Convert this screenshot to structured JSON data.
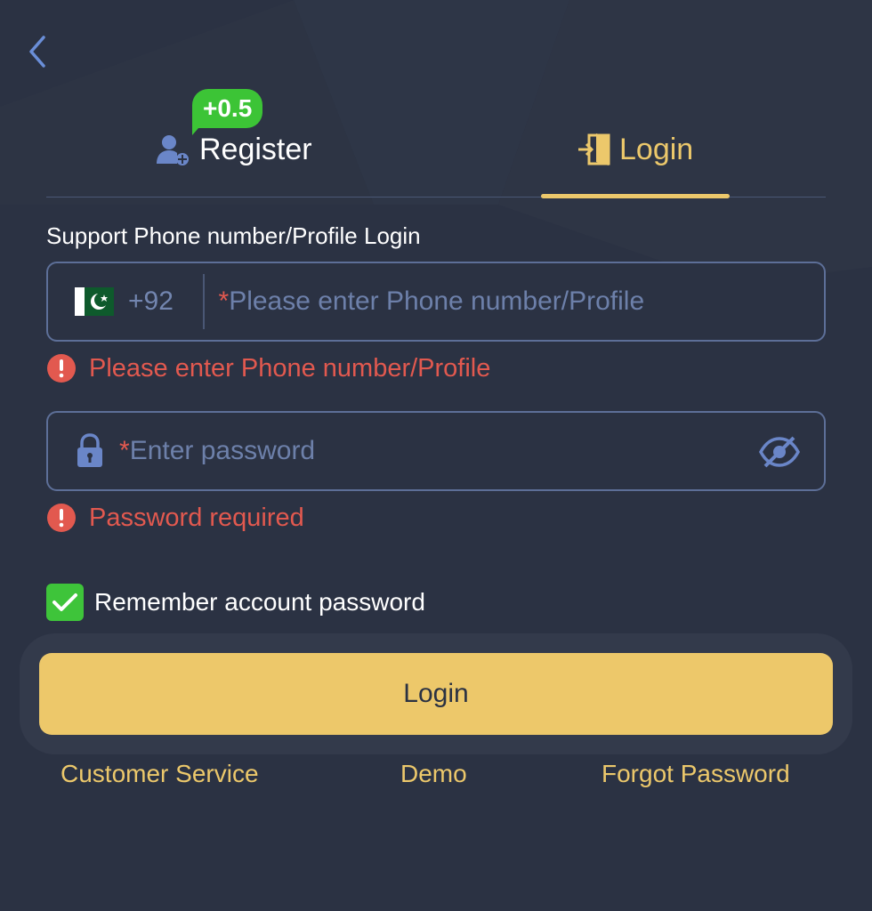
{
  "tabs": {
    "register_label": "Register",
    "register_bonus": "+0.5",
    "login_label": "Login"
  },
  "form": {
    "section_label": "Support Phone number/Profile Login",
    "country_code": "+92",
    "required_mark": "*",
    "phone_placeholder": "Please enter Phone number/Profile",
    "phone_error": "Please enter Phone number/Profile",
    "password_placeholder": "Enter password",
    "password_error": "Password required",
    "remember_label": "Remember account password",
    "remember_checked": true,
    "submit_label": "Login"
  },
  "footer": {
    "customer_service": "Customer Service",
    "demo": "Demo",
    "forgot_password": "Forgot Password"
  },
  "icons": {
    "back": "chevron-left-icon",
    "register": "user-plus-icon",
    "login": "door-enter-icon",
    "flag": "pakistan-flag-icon",
    "lock": "lock-icon",
    "eye": "eye-off-icon",
    "error": "error-icon",
    "check": "checkmark-icon"
  },
  "colors": {
    "background": "#2b3243",
    "accent": "#ecc86b",
    "error": "#e2594f",
    "success": "#3ec43a",
    "field_border": "#5d6f98"
  }
}
